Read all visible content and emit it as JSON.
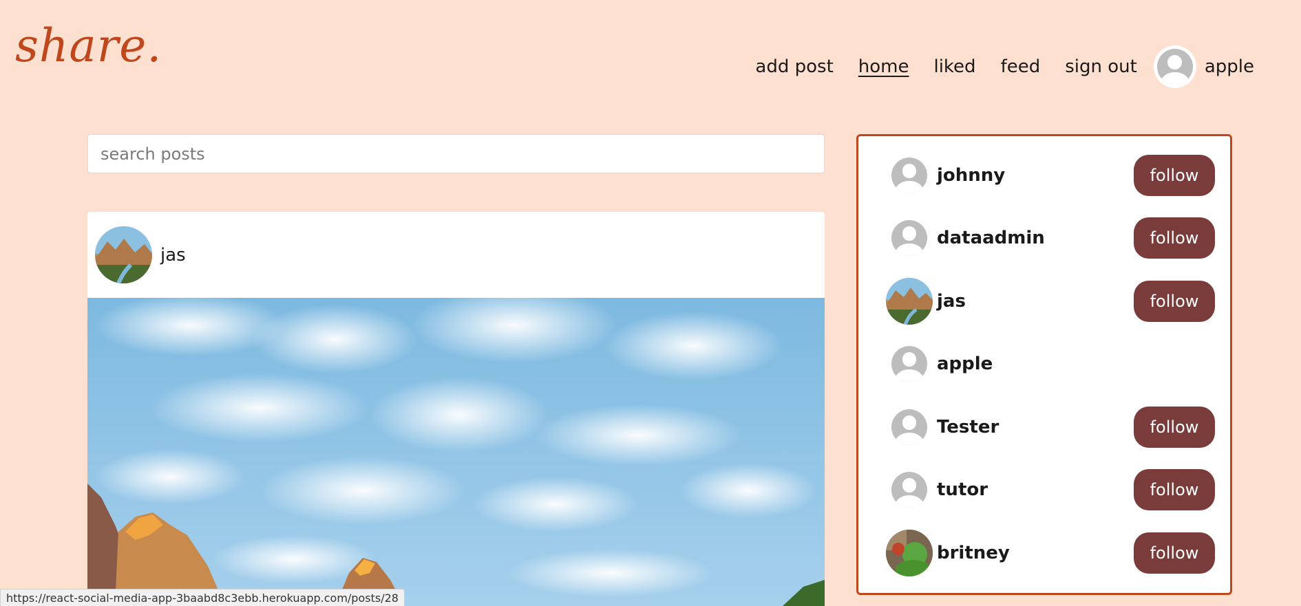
{
  "brand": {
    "logo_text": "share."
  },
  "nav": {
    "links": [
      "add post",
      "home",
      "liked",
      "feed",
      "sign out"
    ],
    "active_link": "home",
    "username": "apple"
  },
  "search": {
    "placeholder": "search posts",
    "value": ""
  },
  "post": {
    "author": "jas",
    "image_description": "landscape-canyon-sky-icon"
  },
  "suggestions": {
    "users": [
      {
        "name": "johnny",
        "avatar": "default-avatar-icon",
        "follow_label": "follow"
      },
      {
        "name": "dataadmin",
        "avatar": "default-avatar-icon",
        "follow_label": "follow"
      },
      {
        "name": "jas",
        "avatar": "photo",
        "follow_label": "follow"
      },
      {
        "name": "apple",
        "avatar": "default-avatar-icon",
        "follow_label": ""
      },
      {
        "name": "Tester",
        "avatar": "default-avatar-icon",
        "follow_label": "follow"
      },
      {
        "name": "tutor",
        "avatar": "default-avatar-icon",
        "follow_label": "follow"
      },
      {
        "name": "britney",
        "avatar": "photo",
        "follow_label": "follow"
      }
    ]
  },
  "status_bar": {
    "url": "https://react-social-media-app-3baabd8c3ebb.herokuapp.com/posts/28"
  },
  "colors": {
    "background": "#fde0d0",
    "brand": "#c0471c",
    "follow_button": "#7a3c3a",
    "panel_border": "#c0471c"
  }
}
